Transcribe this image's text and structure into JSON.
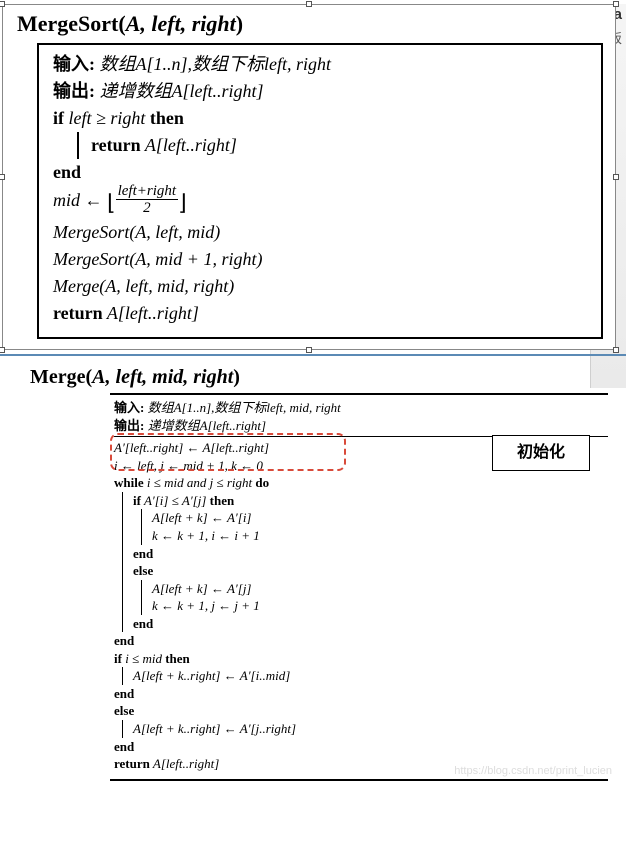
{
  "toolbar": {
    "aa": "Aa",
    "tab_frag": "板"
  },
  "block1": {
    "title_pre": "MergeSort(",
    "title_args": "A, left, right",
    "title_post": ")",
    "input_label": "输入:",
    "input_text": " 数组A[1..n],数组下标left, right",
    "output_label": "输出:",
    "output_text": " 递增数组A[left..right]",
    "if_kw": "if",
    "cond": "  left ≥ right ",
    "then_kw": "then",
    "return_kw": "return",
    "ret1": " A[left..right]",
    "end_kw": "end",
    "mid_lhs": "mid ← ",
    "frac_num": "left+right",
    "frac_den": "2",
    "call1": "MergeSort(A, left, mid)",
    "call2": "MergeSort(A, mid + 1, right)",
    "call3": "Merge(A, left, mid, right)",
    "ret2_kw": "return",
    "ret2": " A[left..right]"
  },
  "block2": {
    "title_pre": "Merge(",
    "title_args": "A, left, mid, right",
    "title_post": ")",
    "input_label": "输入:",
    "input_text": " 数组A[1..n],数组下标left, mid, right",
    "output_label": "输出:",
    "output_text": " 递增数组A[left..right]",
    "init1": "A′[left..right] ← A[left..right]",
    "init2": "i ← left, j ← mid + 1, k ← 0",
    "annotation": "初始化",
    "while_kw": "while",
    "while_cond": " i ≤ mid and j ≤ right ",
    "do_kw": "do",
    "if_kw": "if",
    "if_cond": " A′[i] ≤ A′[j] ",
    "then_kw": "then",
    "stmt1": "A[left + k] ← A′[i]",
    "stmt2": "k ← k + 1, i ← i + 1",
    "end_kw": "end",
    "else_kw": "else",
    "stmt3": "A[left + k] ← A′[j]",
    "stmt4": "k ← k + 1, j ← j + 1",
    "if2_cond": " i ≤ mid ",
    "stmt5": "A[left + k..right] ← A′[i..mid]",
    "stmt6": "A[left + k..right] ← A′[j..right]",
    "return_kw": "return",
    "ret": " A[left..right]"
  },
  "watermark": "https://blog.csdn.net/print_lucien"
}
